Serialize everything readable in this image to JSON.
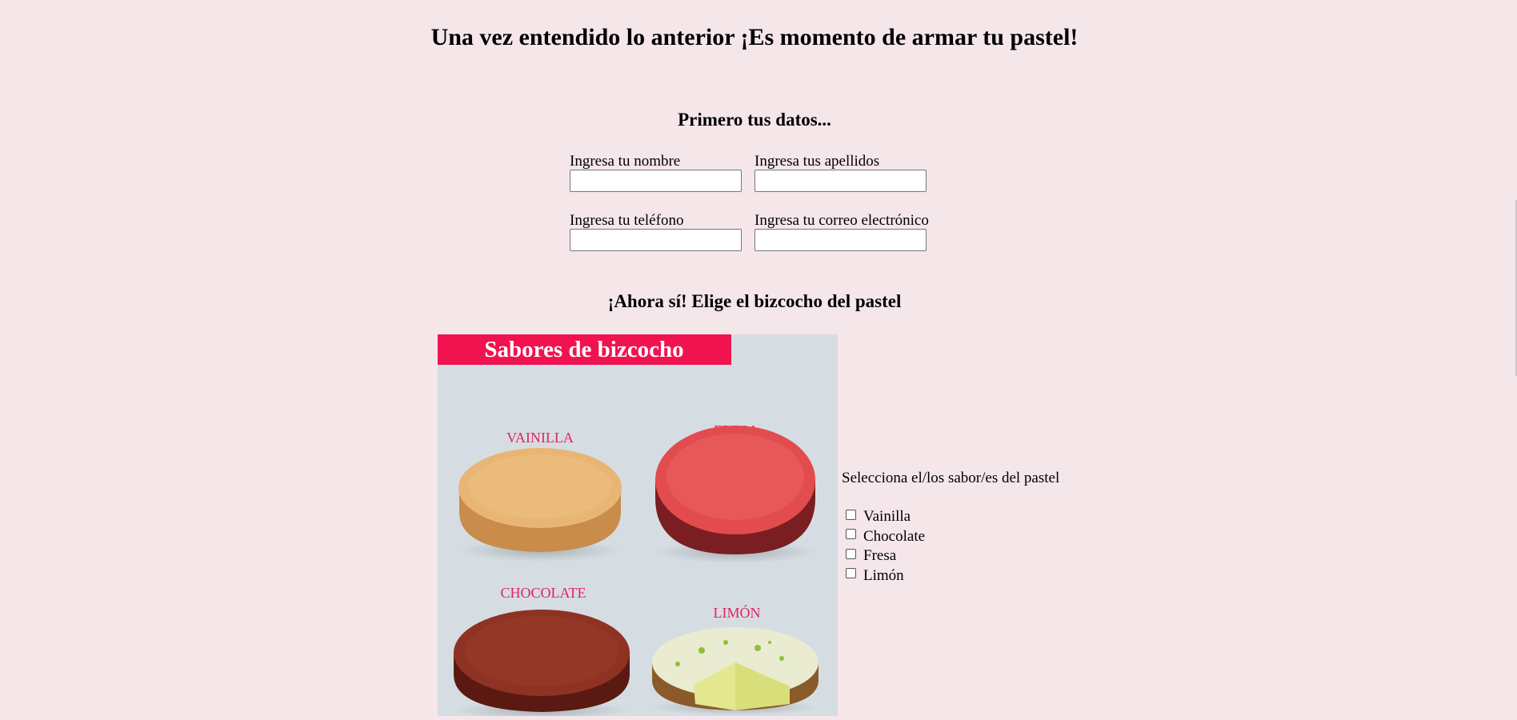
{
  "page": {
    "title": "Una vez entendido lo anterior ¡Es momento de armar tu pastel!"
  },
  "personal": {
    "heading": "Primero tus datos...",
    "fields": [
      {
        "label": "Ingresa tu nombre",
        "value": ""
      },
      {
        "label": "Ingresa tus apellidos",
        "value": ""
      },
      {
        "label": "Ingresa tu teléfono",
        "value": ""
      },
      {
        "label": "Ingresa tu correo electrónico",
        "value": ""
      }
    ]
  },
  "cake": {
    "heading": "¡Ahora sí! Elige el bizcocho del pastel",
    "image": {
      "banner": "Sabores de bizcocho",
      "labels": [
        "VAINILLA",
        "FRESA",
        "CHOCOLATE",
        "LIMÓN"
      ],
      "banner_color": "#f0134f",
      "label_color": "#e0245e"
    },
    "prompt": "Selecciona el/los sabor/es del pastel",
    "flavors": [
      {
        "label": "Vainilla",
        "checked": false
      },
      {
        "label": "Chocolate",
        "checked": false
      },
      {
        "label": "Fresa",
        "checked": false
      },
      {
        "label": "Limón",
        "checked": false
      }
    ]
  },
  "colors": {
    "background": "#f5e6ea"
  }
}
